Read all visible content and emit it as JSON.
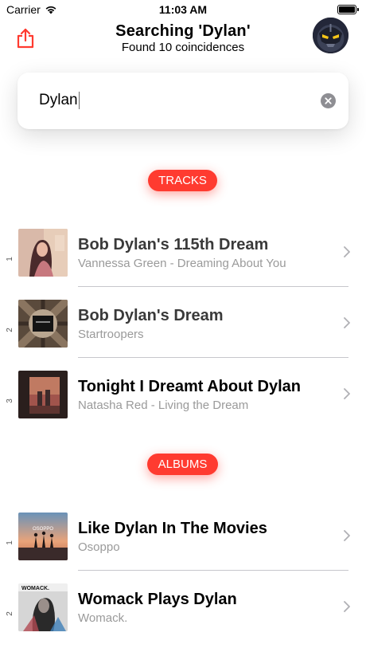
{
  "status_bar": {
    "carrier": "Carrier",
    "time": "11:03 AM"
  },
  "header": {
    "title": "Searching 'Dylan'",
    "subtitle": "Found 10 coincidences",
    "share_icon": "share-icon",
    "avatar": "avatar"
  },
  "search": {
    "value": "Dylan",
    "clear_icon": "clear-icon"
  },
  "sections": {
    "tracks_label": "TRACKS",
    "albums_label": "ALBUMS"
  },
  "tracks": [
    {
      "rank": "1",
      "name": "Bob Dylan's 115th Dream",
      "subtitle": "Vannessa Green - Dreaming About You"
    },
    {
      "rank": "2",
      "name": "Bob Dylan's Dream",
      "subtitle": "Startroopers"
    },
    {
      "rank": "3",
      "name": "Tonight I Dreamt About Dylan",
      "subtitle": "Natasha Red - Living the Dream"
    }
  ],
  "albums": [
    {
      "rank": "1",
      "name": "Like Dylan In The Movies",
      "subtitle": "Osoppo",
      "art_text": "OSOPPO"
    },
    {
      "rank": "2",
      "name": "Womack Plays Dylan",
      "subtitle": "Womack.",
      "art_text": "WOMACK."
    }
  ],
  "colors": {
    "accent": "#ff3b30",
    "secondary_text": "#9a9a9a",
    "divider": "#c7c7cc"
  }
}
